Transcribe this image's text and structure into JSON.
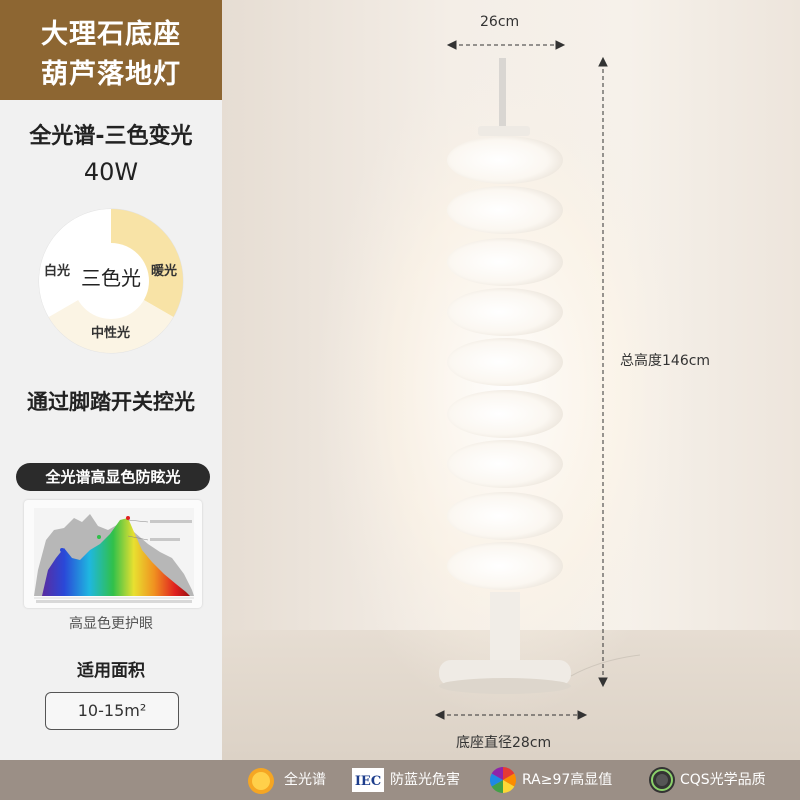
{
  "title": {
    "line1": "大理石底座",
    "line2": "葫芦落地灯"
  },
  "specs": {
    "spectrum": "全光谱-三色变光",
    "power": "40W"
  },
  "color_temp": {
    "center": "三色光",
    "segments": [
      {
        "label": "白光",
        "color": "#ffffff"
      },
      {
        "label": "暖光",
        "color": "#f8e3a6"
      },
      {
        "label": "中性光",
        "color": "#fbf4e4"
      }
    ]
  },
  "feature": "通过脚踏开关控光",
  "spectrum_badge": "全光谱高显色防眩光",
  "spectrum_caption": "高显色更护眼",
  "area": {
    "title": "适用面积",
    "value": "10-15m²"
  },
  "dimensions": {
    "width": "26cm",
    "height": "总高度146cm",
    "base": "底座直径28cm"
  },
  "badges": [
    {
      "icon": "sun-icon",
      "label": "全光谱"
    },
    {
      "icon": "iec-icon",
      "label": "防蓝光危害"
    },
    {
      "icon": "color-wheel-icon",
      "label": "RA≥97高显值"
    },
    {
      "icon": "cqs-icon",
      "label": "CQS光学品质"
    }
  ],
  "colors": {
    "title_bg": "#8d6632",
    "bottom_bar": "#9b8f86",
    "warm": "#f8e3a6"
  }
}
